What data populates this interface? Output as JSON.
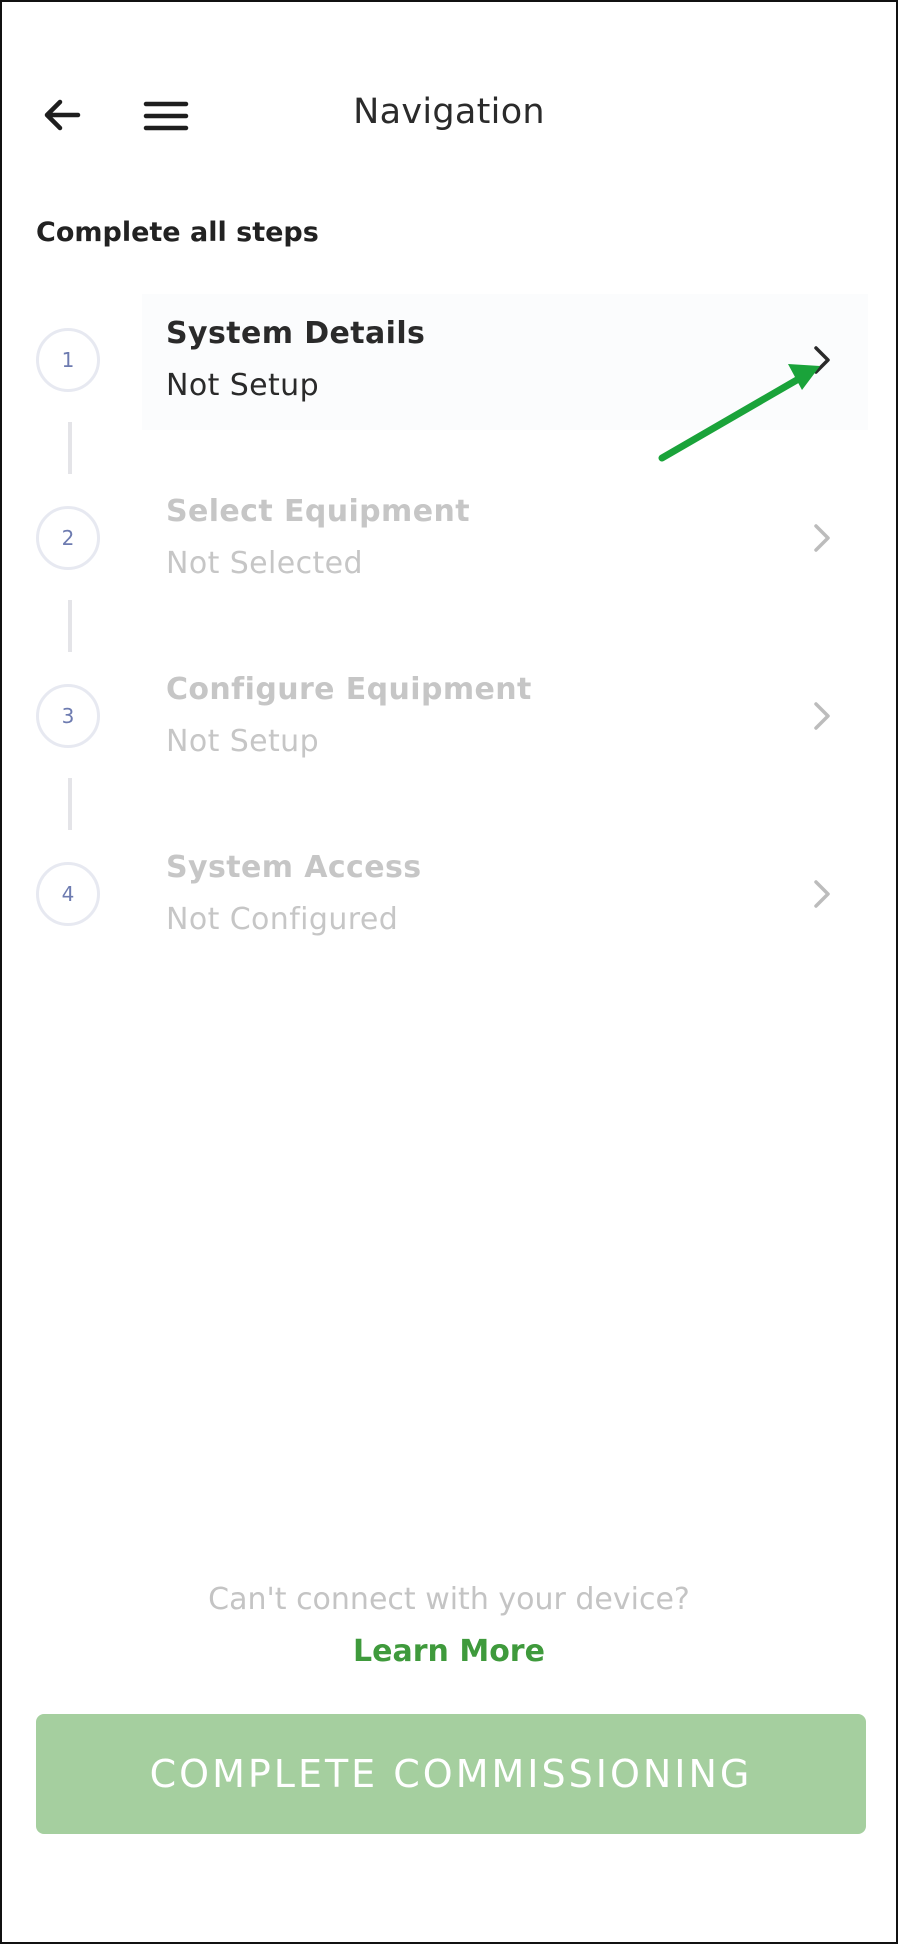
{
  "header": {
    "title": "Navigation",
    "back_icon": "arrow-left-icon",
    "menu_icon": "hamburger-menu-icon"
  },
  "section": {
    "heading": "Complete all steps"
  },
  "steps": [
    {
      "number": "1",
      "title": "System Details",
      "status": "Not Setup",
      "enabled": true
    },
    {
      "number": "2",
      "title": "Select Equipment",
      "status": "Not Selected",
      "enabled": false
    },
    {
      "number": "3",
      "title": "Configure Equipment",
      "status": "Not Setup",
      "enabled": false
    },
    {
      "number": "4",
      "title": "System Access",
      "status": "Not Configured",
      "enabled": false
    }
  ],
  "footer": {
    "hint": "Can't connect with your device?",
    "learn_more": "Learn More",
    "complete_button": "COMPLETE COMMISSIONING"
  },
  "colors": {
    "accent_green": "#3f9a3c",
    "button_disabled_green": "#a5cf9f",
    "annotation_arrow": "#1aa33a"
  }
}
